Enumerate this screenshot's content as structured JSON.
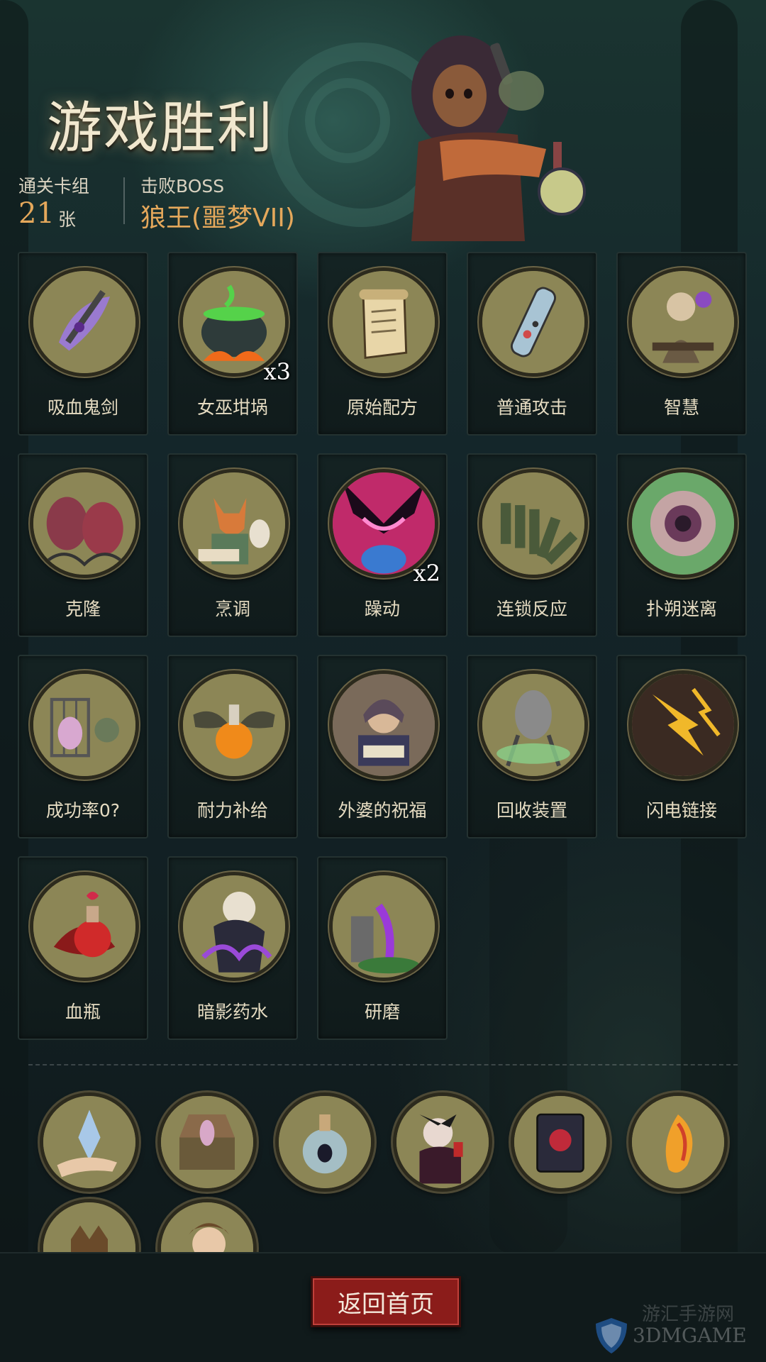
{
  "header": {
    "title": "游戏胜利",
    "deck_label": "通关卡组",
    "deck_count": "21",
    "deck_unit": "张",
    "boss_label": "击败BOSS",
    "boss_name": "狼王(噩梦VII)"
  },
  "cards": [
    {
      "name": "吸血鬼剑",
      "icon": "vampire-sword-icon",
      "mult": ""
    },
    {
      "name": "女巫坩埚",
      "icon": "witch-cauldron-icon",
      "mult": "x3"
    },
    {
      "name": "原始配方",
      "icon": "scroll-icon",
      "mult": ""
    },
    {
      "name": "普通攻击",
      "icon": "potion-tube-icon",
      "mult": ""
    },
    {
      "name": "智慧",
      "icon": "sage-icon",
      "mult": ""
    },
    {
      "name": "克隆",
      "icon": "clone-pods-icon",
      "mult": ""
    },
    {
      "name": "烹调",
      "icon": "fox-chef-icon",
      "mult": ""
    },
    {
      "name": "躁动",
      "icon": "frenzy-face-icon",
      "mult": "x2"
    },
    {
      "name": "连锁反应",
      "icon": "dominoes-icon",
      "mult": ""
    },
    {
      "name": "扑朔迷离",
      "icon": "vortex-icon",
      "mult": ""
    },
    {
      "name": "成功率0?",
      "icon": "caged-creature-icon",
      "mult": ""
    },
    {
      "name": "耐力补给",
      "icon": "winged-flask-icon",
      "mult": ""
    },
    {
      "name": "外婆的祝福",
      "icon": "grandma-icon",
      "mult": ""
    },
    {
      "name": "回收装置",
      "icon": "recycler-icon",
      "mult": ""
    },
    {
      "name": "闪电链接",
      "icon": "lightning-icon",
      "mult": ""
    },
    {
      "name": "血瓶",
      "icon": "blood-potion-icon",
      "mult": ""
    },
    {
      "name": "暗影药水",
      "icon": "shadow-potion-icon",
      "mult": ""
    },
    {
      "name": "研磨",
      "icon": "grinding-icon",
      "mult": ""
    }
  ],
  "relics": [
    {
      "icon": "crystal-hand-icon"
    },
    {
      "icon": "music-box-icon"
    },
    {
      "icon": "spirit-bottle-icon"
    },
    {
      "icon": "vampire-icon"
    },
    {
      "icon": "red-book-icon"
    },
    {
      "icon": "phoenix-feather-icon"
    },
    {
      "icon": "golden-gauntlet-icon"
    },
    {
      "icon": "mad-scientist-icon"
    }
  ],
  "footer": {
    "return_label": "返回首页",
    "watermark_site": "3DMGAME",
    "watermark_cn": "游汇手游网"
  }
}
